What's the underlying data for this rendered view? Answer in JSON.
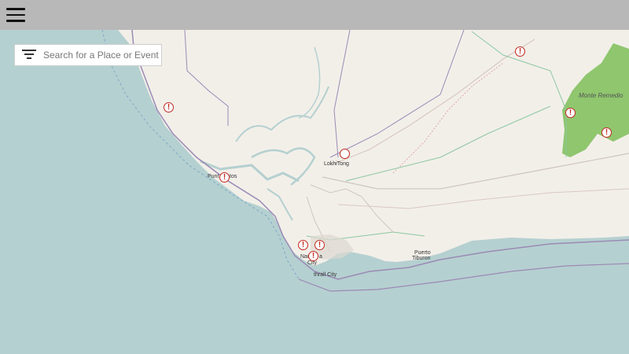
{
  "header": {
    "menu_icon": "hamburger-menu-icon"
  },
  "search": {
    "placeholder": "Search for a Place or Event",
    "filter_icon": "filter-icon"
  },
  "colors": {
    "sea": "#b5d0d0",
    "land": "#f2efe9",
    "park": "#8fc66e",
    "marker": "#c0281f",
    "topbar": "#b8b8b8"
  },
  "places": {
    "puntos": "Punt       tos",
    "lokhitong": "LokhiTong",
    "monte": "Monte Remedio",
    "nar": "Nar",
    "nar_suffix": "a",
    "city": "City",
    "thrall": "thrall City",
    "puerto": "Puerto",
    "tiburon": "Tiburon"
  },
  "markers": [
    {
      "glyph": "!"
    },
    {
      "glyph": "!"
    },
    {
      "glyph": "!"
    },
    {
      "glyph": "!"
    },
    {
      "glyph": "!"
    },
    {
      "glyph": "!"
    },
    {
      "glyph": "!"
    },
    {
      "glyph": ""
    }
  ]
}
